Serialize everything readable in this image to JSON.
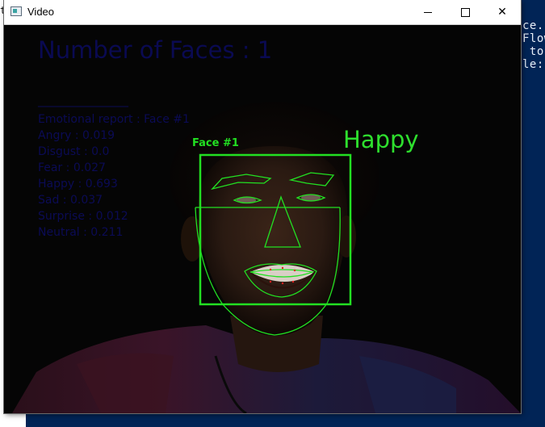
{
  "terminal": {
    "corner_text": "te",
    "lines": [
      "ce.p",
      "Flow",
      " to ",
      "le:"
    ]
  },
  "window": {
    "title": "Video",
    "controls": {
      "minimize": "minimize",
      "maximize": "maximize",
      "close": "✕"
    }
  },
  "video": {
    "face_count_text": "Number of Faces : 1",
    "separator": "________________",
    "report": [
      "Emotional report : Face #1",
      "Angry : 0.019",
      "Disgust : 0.0",
      "Fear : 0.027",
      "Happy : 0.693",
      "Sad : 0.037",
      "Surprise : 0.012",
      "Neutral : 0.211"
    ],
    "face_label": "Face #1",
    "emotion": "Happy",
    "colors": {
      "landmark_green": "#22e022",
      "text_navy": "#0b0b55",
      "terminal_blue": "#012456"
    }
  }
}
